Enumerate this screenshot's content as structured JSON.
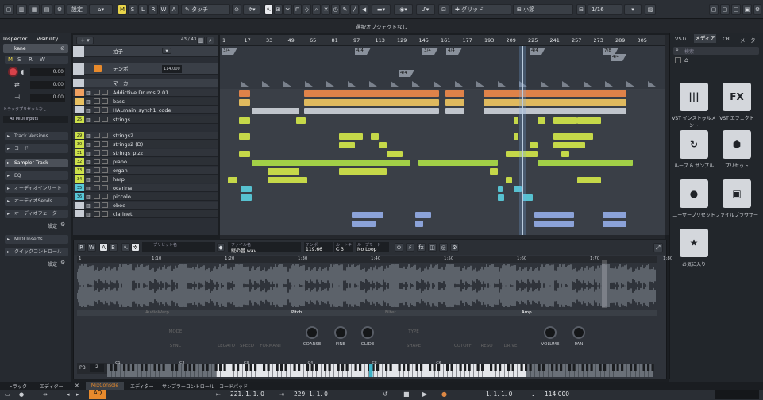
{
  "toolbar": {
    "settings_label": "設定",
    "mode_label": "タッチ",
    "m": "M",
    "s": "S",
    "l": "L",
    "r": "R",
    "w": "W",
    "a": "A",
    "grid_label": "グリッド",
    "snap_label": "小節",
    "quantize_label": "1/16"
  },
  "info_line": "選択オブジェクトなし",
  "inspector": {
    "tab_inspector": "Inspector",
    "tab_visibility": "Visibility",
    "track_name": "kane",
    "value1": "0.00",
    "value2": "0.00",
    "value3": "0.00",
    "track_off": "トラックプリセットなし",
    "midi_inputs": "All MIDI Inputs",
    "sections": [
      "Track Versions",
      "コード",
      "Sampler Track",
      "EQ",
      "オーディオインサート",
      "オーディオSends",
      "オーディオフェーダー",
      "MIDI Inserts",
      "クイックコントロール"
    ],
    "settings1": "設定",
    "settings2": "設定"
  },
  "tracklist": {
    "count": "43 / 43",
    "rows": [
      {
        "num": "",
        "name": "拍子",
        "color": "#c7ccd4"
      },
      {
        "num": "",
        "name": "テンポ",
        "color": "#c7ccd4"
      },
      {
        "num": "",
        "name": "マーカー",
        "color": "#c7ccd4"
      },
      {
        "num": "",
        "name": "Addictive Drums 2 01",
        "color": "#f0a060"
      },
      {
        "num": "",
        "name": "bass",
        "color": "#e8c060"
      },
      {
        "num": "",
        "name": "HALmain_synth1_code",
        "color": "#c7ccd4"
      },
      {
        "num": "25",
        "name": "strings",
        "color": "#cce04a"
      },
      {
        "num": "29",
        "name": "strings2",
        "color": "#cce04a"
      },
      {
        "num": "30",
        "name": "strings2 (D)",
        "color": "#cce04a"
      },
      {
        "num": "31",
        "name": "strings_pizz",
        "color": "#cce04a"
      },
      {
        "num": "32",
        "name": "piano",
        "color": "#cce04a"
      },
      {
        "num": "33",
        "name": "organ",
        "color": "#cce04a"
      },
      {
        "num": "34",
        "name": "harp",
        "color": "#cce04a"
      },
      {
        "num": "35",
        "name": "ocarina",
        "color": "#58c8d8"
      },
      {
        "num": "36",
        "name": "piccolo",
        "color": "#58c8d8"
      },
      {
        "num": "",
        "name": "oboe",
        "color": "#c7ccd4"
      },
      {
        "num": "",
        "name": "clarinet",
        "color": "#c7ccd4"
      }
    ],
    "tempo_value": "114.000"
  },
  "ruler": {
    "marks": [
      "1",
      "17",
      "33",
      "49",
      "65",
      "81",
      "97",
      "113",
      "129",
      "145",
      "161",
      "177",
      "193",
      "209",
      "225",
      "241",
      "257",
      "273",
      "289",
      "305"
    ]
  },
  "signatures": [
    "3/4",
    "4/4",
    "4/4",
    "3/4",
    "4/4",
    "4/4",
    "7/8",
    "4/4"
  ],
  "media": {
    "tab_vsti": "VSTi",
    "tab_media": "メディア",
    "tab_cr": "CR",
    "tab_meter": "メーター",
    "search_placeholder": "検索",
    "tiles": [
      {
        "glyph": "|||",
        "label": "VST インストゥルメント"
      },
      {
        "glyph": "FX",
        "label": "VST エフェクト"
      },
      {
        "glyph": "↻",
        "label": "ループ & サンプル"
      },
      {
        "glyph": "⬢",
        "label": "プリセット"
      },
      {
        "glyph": "●",
        "label": "ユーザープリセット"
      },
      {
        "glyph": "▣",
        "label": "ファイルブラウザー"
      },
      {
        "glyph": "★",
        "label": "お気に入り"
      }
    ]
  },
  "editor": {
    "r": "R",
    "w": "W",
    "a": "A",
    "b": "B",
    "preset_label": "プリセット名",
    "file_label": "ファイル名",
    "file_name": "縦の音.wav",
    "tempo_label": "テンポ",
    "tempo_value": "119.66",
    "root_label": "ルートキー",
    "root_value": "C 3",
    "loop_label": "ループモード",
    "loop_value": "No Loop",
    "ruler_marks": [
      "1",
      "1:10",
      "1:20",
      "1:30",
      "1:40",
      "1:50",
      "1:60",
      "1:70",
      "1:80"
    ],
    "sections": [
      "AudioWarp",
      "Pitch",
      "Filter",
      "Amp"
    ],
    "dim_knobs": [
      "MODE",
      "SYNC",
      "LEGATO",
      "SPEED",
      "FORMANT",
      "TYPE",
      "SHAPE",
      "CUTOFF",
      "RESO",
      "DRIVE"
    ],
    "dim_values": {
      "mode": "Music",
      "sync": "Off",
      "type": "Tube",
      "shape": "LP24"
    },
    "knobs": [
      "COARSE",
      "FINE",
      "GLIDE",
      "VOLUME",
      "PAN"
    ],
    "pb_label": "PB",
    "pb_value": "2",
    "keys": [
      "C1",
      "C2",
      "C3",
      "C4",
      "C5",
      "C6"
    ]
  },
  "bottom_tabs": [
    "トラック",
    "エディター",
    "MixConsole",
    "エディター",
    "サンプラーコントロール",
    "コードパッド"
  ],
  "transport": {
    "pos1": "221. 1. 1. 0",
    "pos2": "229. 1. 1. 0",
    "pos3": "1. 1. 1. 0",
    "tempo": "114.000"
  }
}
